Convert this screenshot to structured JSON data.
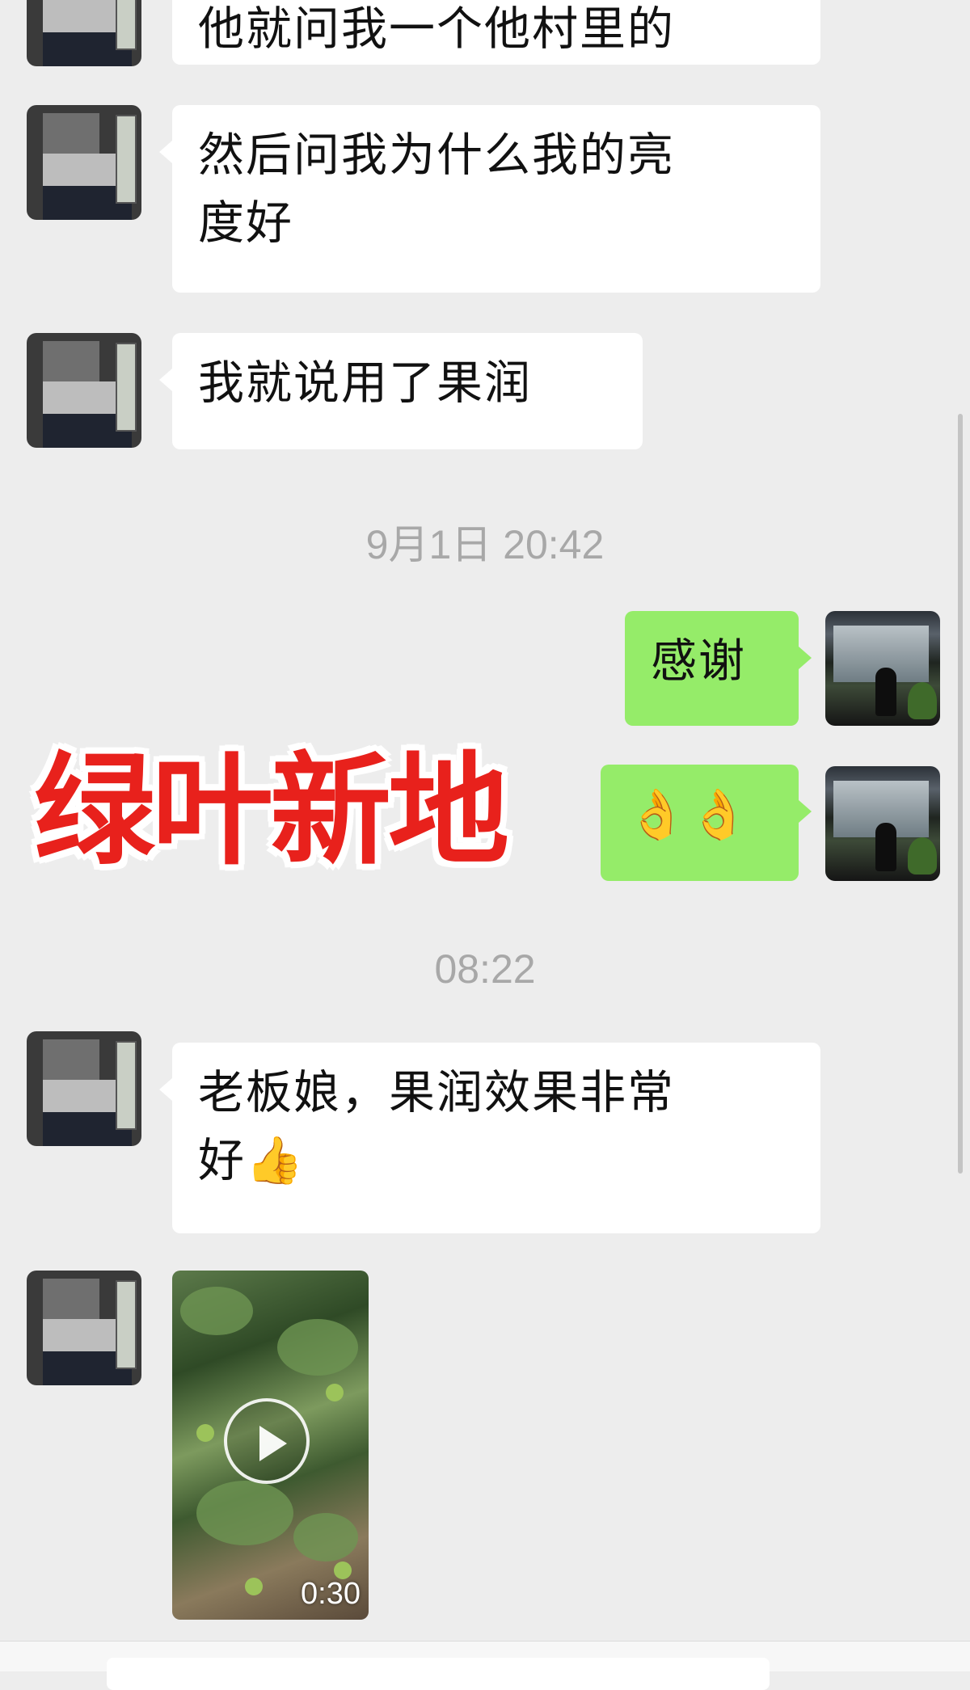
{
  "messages": [
    {
      "side": "left",
      "text": "他就问我一个他村里的"
    },
    {
      "side": "left",
      "text_line1": "然后问我为什么我的亮",
      "text_line2": "度好"
    },
    {
      "side": "left",
      "text": "我就说用了果润"
    },
    {
      "timestamp": "9月1日 20:42"
    },
    {
      "side": "right",
      "text": "感谢"
    },
    {
      "side": "right",
      "emoji": "👌👌",
      "icon": "ok-hand-emoji"
    },
    {
      "timestamp": "08:22"
    },
    {
      "side": "left",
      "text_line1": "老板娘，果润效果非常",
      "text_line2": "好👍",
      "icon": "thumbs-up-emoji"
    },
    {
      "side": "left",
      "video": {
        "duration": "0:30",
        "icon": "play-icon"
      }
    }
  ],
  "watermark": "绿叶新地",
  "colors": {
    "background": "#ededed",
    "incoming_bubble": "#ffffff",
    "outgoing_bubble": "#95ec69",
    "timestamp": "#a8a8a8",
    "watermark": "#e8211c"
  }
}
